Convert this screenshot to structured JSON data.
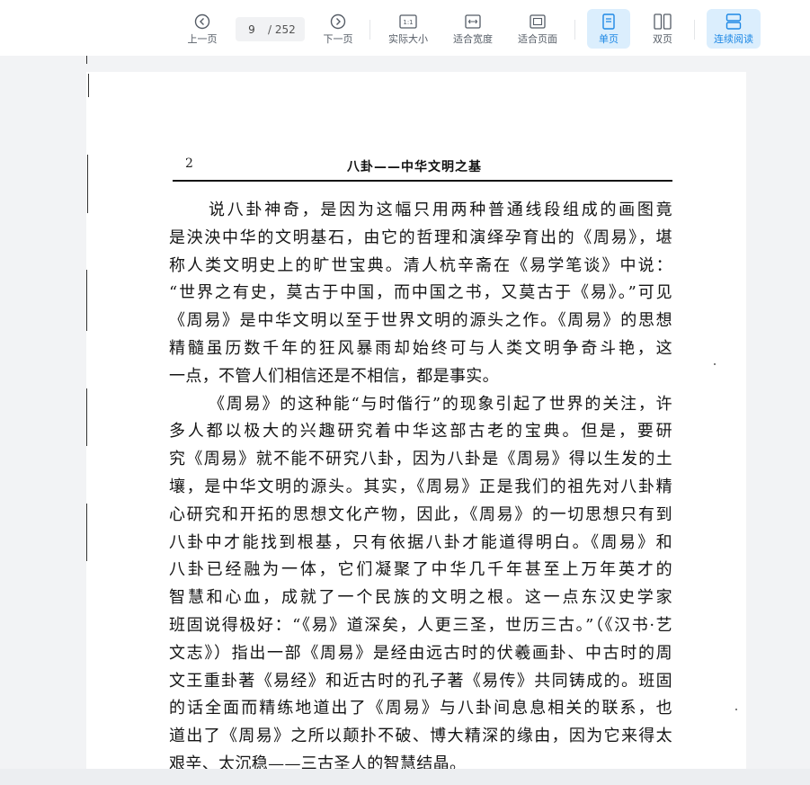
{
  "toolbar": {
    "prev": "上一页",
    "current_page": "9",
    "total_pages": "/ 252",
    "next": "下一页",
    "actual_size": "实际大小",
    "actual_size_icon_text": "1:1",
    "fit_width": "适合宽度",
    "fit_page": "适合页面",
    "single_page": "单页",
    "double_page": "双页",
    "continuous": "连续阅读",
    "accent": "#1e88e5"
  },
  "document": {
    "page_number": "2",
    "running_title": "八卦——中华文明之基",
    "lines": [
      "说八卦神奇，是因为这幅只用两种普通线段组成的画图竟",
      "是泱泱中华的文明基石，由它的哲理和演绎孕育出的《周易》，堪",
      "称人类文明史上的旷世宝典。清人杭辛斋在《易学笔谈》中说：",
      "“世界之有史，莫古于中国，而中国之书，又莫古于《易》。”可见",
      "《周易》是中华文明以至于世界文明的源头之作。《周易》的思想",
      "精髓虽历数千年的狂风暴雨却始终可与人类文明争奇斗艳，这",
      "一点，不管人们相信还是不相信，都是事实。",
      "《周易》的这种能“与时偕行”的现象引起了世界的关注，许",
      "多人都以极大的兴趣研究着中华这部古老的宝典。但是，要研",
      "究《周易》就不能不研究八卦，因为八卦是《周易》得以生发的土",
      "壤，是中华文明的源头。其实，《周易》正是我们的祖先对八卦精",
      "心研究和开拓的思想文化产物，因此，《周易》的一切思想只有到",
      "八卦中才能找到根基，只有依据八卦才能道得明白。《周易》和",
      "八卦已经融为一体，它们凝聚了中华几千年甚至上万年英才的",
      "智慧和心血，成就了一个民族的文明之根。这一点东汉史学家",
      "班固说得极好：“《易》道深矣，人更三圣，世历三古。”（《汉书·艺",
      "文志》）指出一部《周易》是经由远古时的伏羲画卦、中古时的周",
      "文王重卦著《易经》和近古时的孔子著《易传》共同铸成的。班固",
      "的话全面而精练地道出了《周易》与八卦间息息相关的联系，也",
      "道出了《周易》之所以颠扑不破、博大精深的缘由，因为它来得太",
      "艰辛、太沉稳——三古圣人的智慧结晶。"
    ]
  }
}
